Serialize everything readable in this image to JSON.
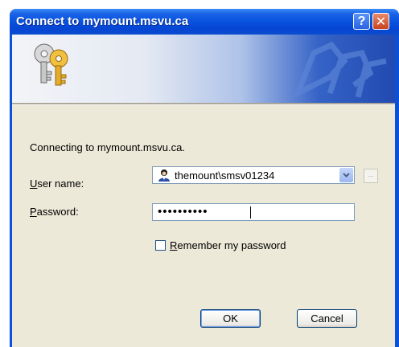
{
  "window": {
    "title": "Connect to mymount.msvu.ca",
    "help_glyph": "?",
    "close_glyph": "✕"
  },
  "dialog": {
    "message": "Connecting to mymount.msvu.ca.",
    "username_label_key": "U",
    "username_label_rest": "ser name:",
    "username_value": "themount\\smsv01234",
    "browse_label": "...",
    "password_label_key": "P",
    "password_label_rest": "assword:",
    "password_value": "••••••••••",
    "remember_label_key": "R",
    "remember_label_rest": "emember my password",
    "remember_checked": false
  },
  "buttons": {
    "ok": "OK",
    "cancel": "Cancel"
  },
  "icons": [
    "keys-icon",
    "user-icon",
    "chevron-down-icon",
    "help-icon",
    "close-icon"
  ],
  "colors": {
    "titlebar": "#0a55e0",
    "dialog_bg": "#ece9d8",
    "field_border": "#7f9db9"
  }
}
